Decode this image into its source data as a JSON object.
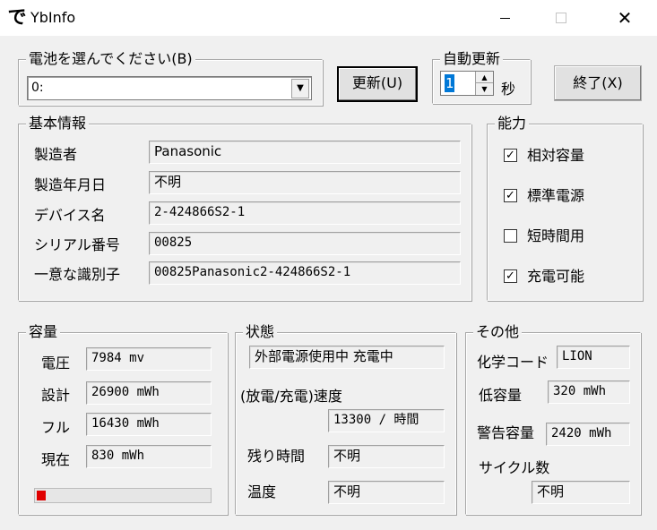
{
  "window": {
    "app_icon_glyph": "で",
    "title": "YbInfo",
    "close_glyph": "✕"
  },
  "battery_select": {
    "legend": "電池を選んでください(B)",
    "value": "0:"
  },
  "update_button": {
    "label": "更新(U)"
  },
  "auto_update": {
    "legend": "自動更新",
    "value": "1",
    "unit": "秒"
  },
  "exit_button": {
    "label": "終了(X)"
  },
  "basic_info": {
    "legend": "基本情報",
    "rows": [
      {
        "label": "製造者",
        "value": "Panasonic"
      },
      {
        "label": "製造年月日",
        "value": "不明"
      },
      {
        "label": "デバイス名",
        "value": "2-424866S2-1"
      },
      {
        "label": "シリアル番号",
        "value": "00825"
      },
      {
        "label": "一意な識別子",
        "value": "00825Panasonic2-424866S2-1"
      }
    ]
  },
  "capability": {
    "legend": "能力",
    "items": [
      {
        "label": "相対容量",
        "checked": true
      },
      {
        "label": "標準電源",
        "checked": true
      },
      {
        "label": "短時間用",
        "checked": false
      },
      {
        "label": "充電可能",
        "checked": true
      }
    ]
  },
  "capacity": {
    "legend": "容量",
    "rows": [
      {
        "label": "電圧",
        "value": "7984 mv"
      },
      {
        "label": "設計",
        "value": "26900 mWh"
      },
      {
        "label": "フル",
        "value": "16430 mWh"
      },
      {
        "label": "現在",
        "value": "830 mWh"
      }
    ],
    "charge_fraction": 0.05
  },
  "status": {
    "legend": "状態",
    "state_value": "外部電源使用中 充電中",
    "rate_label": "(放電/充電)速度",
    "rate_value": "13300 / 時間",
    "remaining_label": "残り時間",
    "remaining_value": "不明",
    "temp_label": "温度",
    "temp_value": "不明"
  },
  "other": {
    "legend": "その他",
    "chem_label": "化学コード",
    "chem_value": "LION",
    "low_label": "低容量",
    "low_value": "320 mWh",
    "warn_label": "警告容量",
    "warn_value": "2420 mWh",
    "cycle_label": "サイクル数",
    "cycle_value": "不明"
  }
}
